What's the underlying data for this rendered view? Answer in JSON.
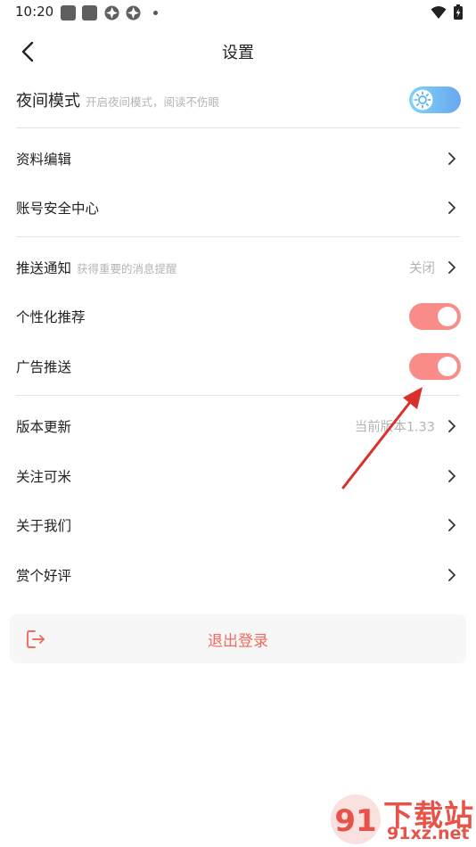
{
  "status_bar": {
    "time": "10:20",
    "icons": [
      "notification-square-icon",
      "notification-square-icon",
      "shutter-icon",
      "shutter-icon",
      "dot-icon",
      "wifi-icon",
      "battery-charging-icon"
    ]
  },
  "header": {
    "title": "设置",
    "back_icon": "chevron-left-icon"
  },
  "night_mode": {
    "label": "夜间模式",
    "hint": "开启夜间模式，阅读不伤眼",
    "icon": "sun-icon",
    "enabled": false
  },
  "account": {
    "items": [
      {
        "label": "资料编辑"
      },
      {
        "label": "账号安全中心"
      }
    ]
  },
  "notifications": {
    "push": {
      "label": "推送通知",
      "hint": "获得重要的消息提醒",
      "value": "关闭"
    },
    "personalized": {
      "label": "个性化推荐",
      "enabled": true
    },
    "ads": {
      "label": "广告推送",
      "enabled": true
    }
  },
  "about": {
    "version": {
      "label": "版本更新",
      "value": "当前版本1.33"
    },
    "items": [
      {
        "label": "关注可米"
      },
      {
        "label": "关于我们"
      },
      {
        "label": "赏个好评"
      }
    ]
  },
  "logout": {
    "label": "退出登录",
    "icon": "logout-icon"
  },
  "watermark": {
    "line1": "下载站",
    "line2": "91xz.net",
    "logo_text": "91"
  },
  "colors": {
    "toggle_on": "#f98b88",
    "logout_text": "#f26b5e",
    "night_toggle": "#7fc6f4",
    "annotation_arrow": "#d9302c",
    "divider": "#e4e4e4",
    "hint_text": "#b4b4b4"
  }
}
